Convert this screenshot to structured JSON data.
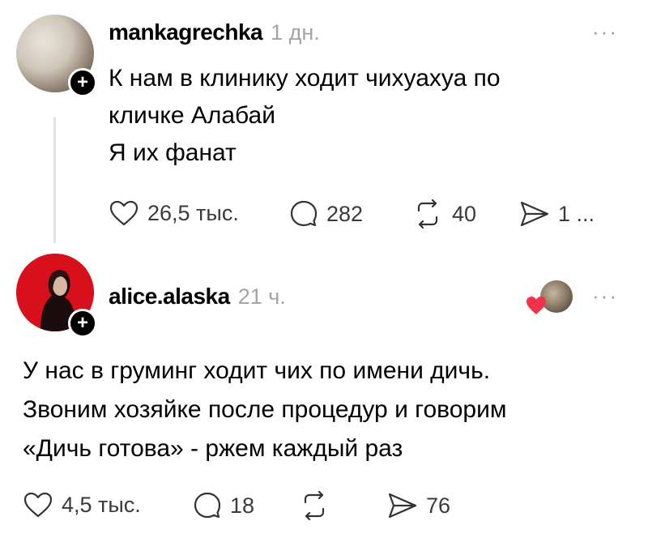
{
  "posts": [
    {
      "username": "mankagrechka",
      "time": "1 дн.",
      "lines": [
        "К нам в клинику ходит чихуахуа по",
        "кличке Алабай",
        "Я их фанат"
      ],
      "likes": "26,5 тыс.",
      "comments": "282",
      "reposts": "40",
      "shares": "1 ..."
    },
    {
      "username": "alice.alaska",
      "time": "21 ч.",
      "lines": [
        "У нас в груминг ходит чих по имени дичь.",
        "Звоним хозяйке после процедур и говорим",
        "«Дичь готова» - ржем каждый раз"
      ],
      "likes": "4,5 тыс.",
      "comments": "18",
      "shares": "76"
    }
  ],
  "ui": {
    "more_glyph": "···",
    "follow_glyph": "+"
  },
  "colors": {
    "like_heart": "#f0334a",
    "text": "#000000",
    "muted": "#a4a4a4"
  },
  "icons": [
    "heart-icon",
    "comment-icon",
    "repost-icon",
    "share-icon",
    "more-icon",
    "follow-plus-icon"
  ]
}
